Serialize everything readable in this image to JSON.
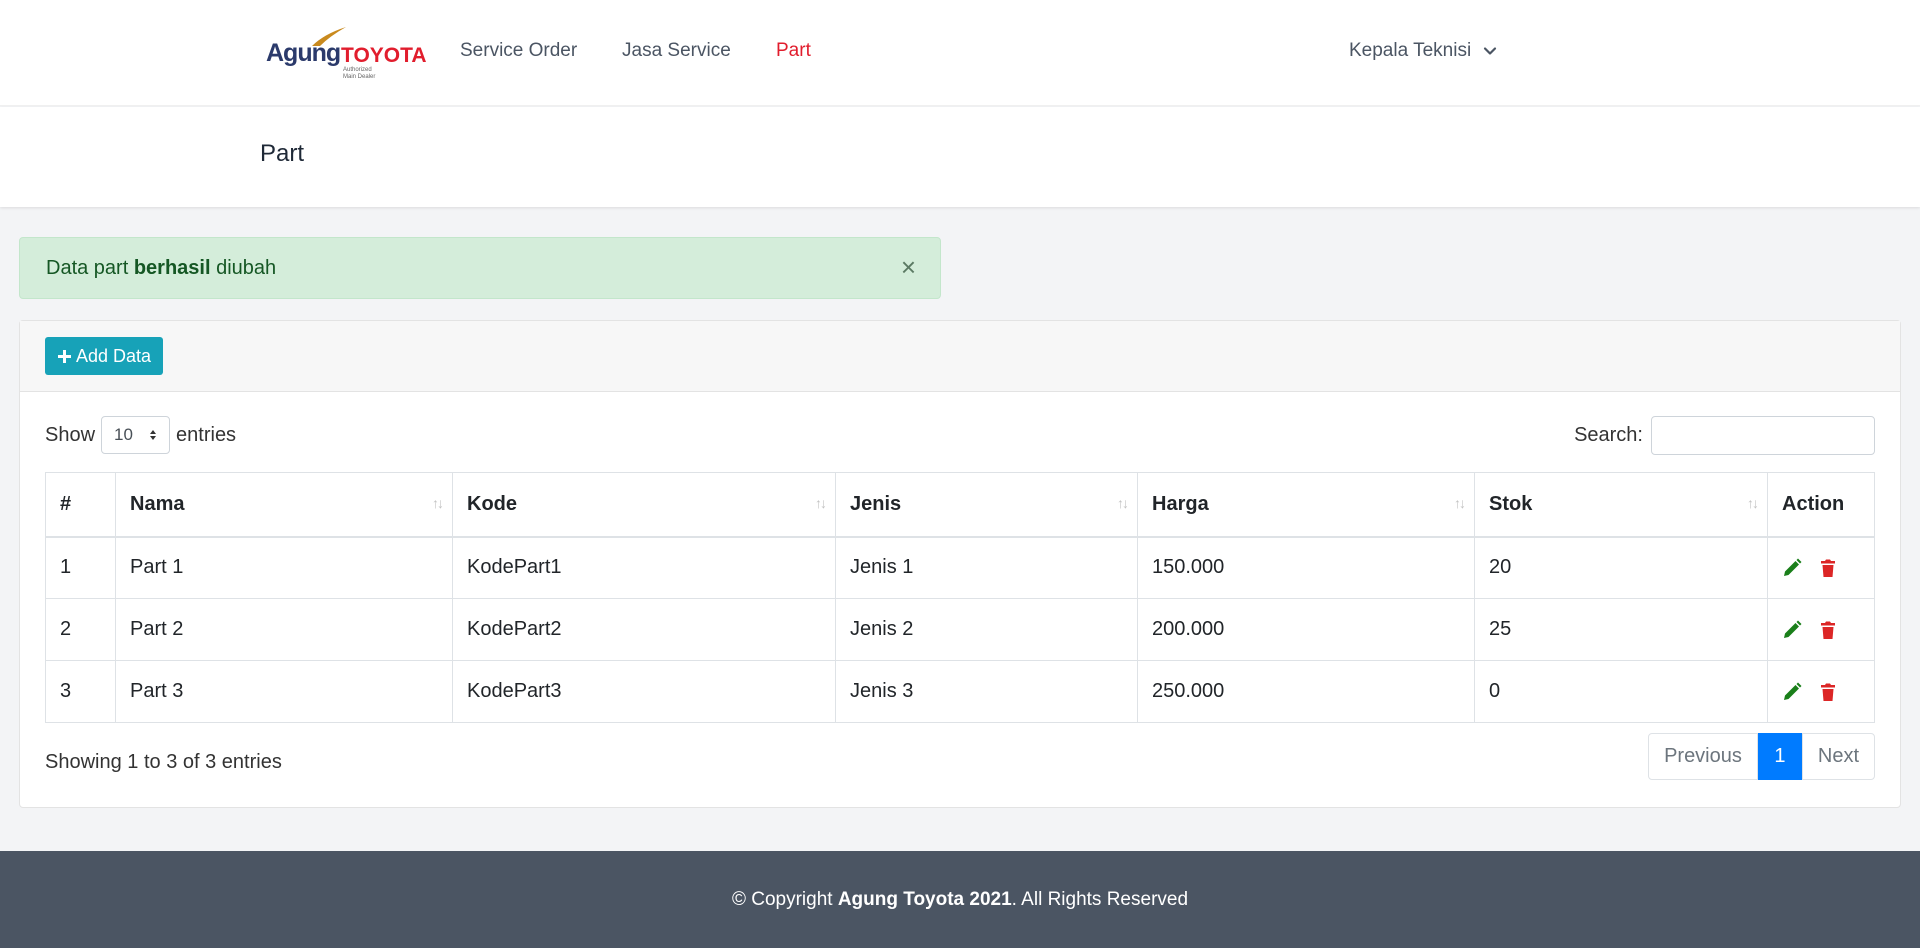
{
  "brand": {
    "name_part1": "Agung",
    "name_part2": "TOYOTA",
    "tagline_line1": "Authorized",
    "tagline_line2": "Main Dealer"
  },
  "nav": {
    "items": [
      {
        "label": "Service Order"
      },
      {
        "label": "Jasa Service"
      },
      {
        "label": "Part"
      }
    ],
    "active_color": "#e11d2d",
    "user_label": "Kepala Teknisi"
  },
  "page": {
    "title": "Part"
  },
  "alert": {
    "text_before": "Data part ",
    "text_bold": "berhasil",
    "text_after": " diubah",
    "close_glyph": "×"
  },
  "toolbar": {
    "add_label": "Add Data"
  },
  "table_controls": {
    "show_label": "Show",
    "entries_value": "10",
    "entries_label": "entries",
    "search_label": "Search:",
    "search_value": ""
  },
  "table": {
    "columns": [
      "#",
      "Nama",
      "Kode",
      "Jenis",
      "Harga",
      "Stok",
      "Action"
    ],
    "rows": [
      {
        "no": "1",
        "nama": "Part 1",
        "kode": "KodePart1",
        "jenis": "Jenis 1",
        "harga": "150.000",
        "stok": "20"
      },
      {
        "no": "2",
        "nama": "Part 2",
        "kode": "KodePart2",
        "jenis": "Jenis 2",
        "harga": "200.000",
        "stok": "25"
      },
      {
        "no": "3",
        "nama": "Part 3",
        "kode": "KodePart3",
        "jenis": "Jenis 3",
        "harga": "250.000",
        "stok": "0"
      }
    ],
    "edit_icon": "pencil-icon",
    "delete_icon": "trash-icon",
    "edit_color": "#1a7f1a",
    "delete_color": "#dc2626"
  },
  "footer_info": {
    "text": "Showing 1 to 3 of 3 entries"
  },
  "pagination": {
    "previous": "Previous",
    "current": "1",
    "next": "Next"
  },
  "footer": {
    "prefix": "© Copyright ",
    "bold": "Agung Toyota 2021",
    "suffix": ". All Rights Reserved"
  }
}
